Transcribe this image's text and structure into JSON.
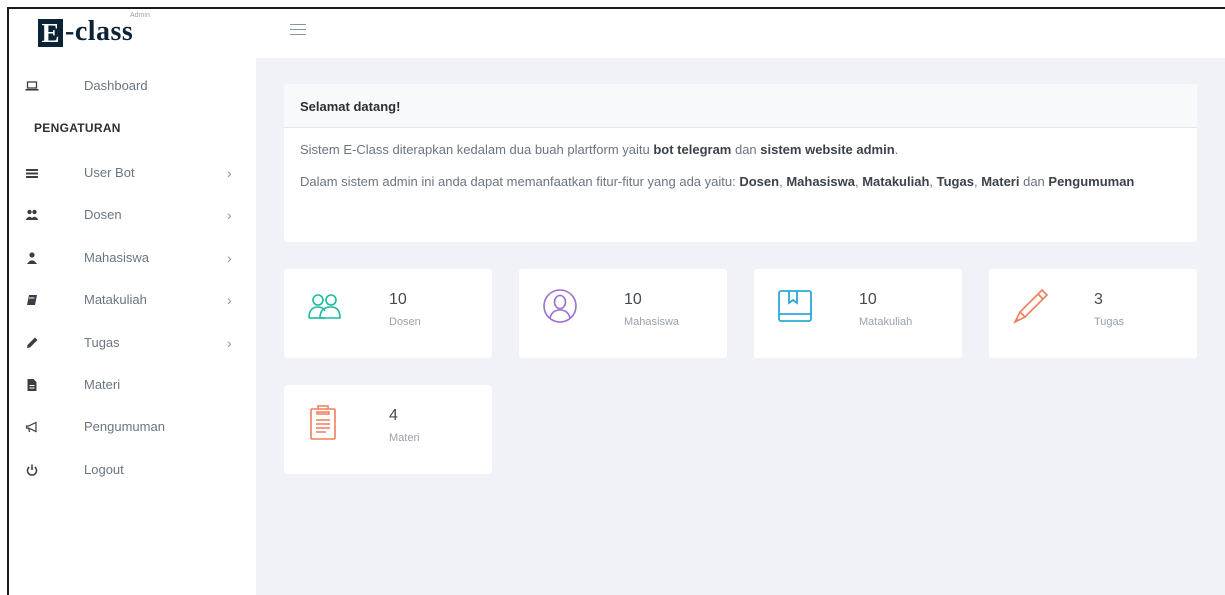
{
  "brand": {
    "letter": "E",
    "rest": "-class",
    "badge": "Admin"
  },
  "sidebar": {
    "section_title": "PENGATURAN",
    "dashboard": {
      "label": "Dashboard",
      "icon": "laptop-icon"
    },
    "items": [
      {
        "label": "User Bot",
        "icon": "list-icon",
        "has_submenu": true
      },
      {
        "label": "Dosen",
        "icon": "users-icon",
        "has_submenu": true
      },
      {
        "label": "Mahasiswa",
        "icon": "user-icon",
        "has_submenu": true
      },
      {
        "label": "Matakuliah",
        "icon": "book-icon",
        "has_submenu": true
      },
      {
        "label": "Tugas",
        "icon": "pencil-icon",
        "has_submenu": true
      },
      {
        "label": "Materi",
        "icon": "file-icon",
        "has_submenu": false
      },
      {
        "label": "Pengumuman",
        "icon": "bullhorn-icon",
        "has_submenu": false
      },
      {
        "label": "Logout",
        "icon": "power-icon",
        "has_submenu": false
      }
    ],
    "chevron": "›"
  },
  "welcome": {
    "title": "Selamat datang!",
    "p1_a": "Sistem E-Class diterapkan kedalam dua buah plartform yaitu ",
    "p1_b": "bot telegram",
    "p1_c": " dan ",
    "p1_d": "sistem website admin",
    "p1_e": ".",
    "p2_a": "Dalam sistem admin ini anda dapat memanfaatkan fitur-fitur yang ada yaitu: ",
    "p2_dosen": "Dosen",
    "p2_sep1": ", ",
    "p2_mahasiswa": "Mahasiswa",
    "p2_sep2": ", ",
    "p2_matakuliah": "Matakuliah",
    "p2_sep3": ", ",
    "p2_tugas": "Tugas",
    "p2_sep4": ", ",
    "p2_materi": "Materi",
    "p2_dan": " dan ",
    "p2_pengumuman": "Pengumuman"
  },
  "stats": [
    {
      "value": "10",
      "label": "Dosen",
      "icon": "users-outline-icon",
      "color": "#1abc9c"
    },
    {
      "value": "10",
      "label": "Mahasiswa",
      "icon": "user-circle-icon",
      "color": "#9b6fd0"
    },
    {
      "value": "10",
      "label": "Matakuliah",
      "icon": "book-outline-icon",
      "color": "#2aa9d6"
    },
    {
      "value": "3",
      "label": "Tugas",
      "icon": "pen-icon",
      "color": "#ef7f5a"
    },
    {
      "value": "4",
      "label": "Materi",
      "icon": "clipboard-icon",
      "color": "#ef7f5a"
    }
  ],
  "colors": {
    "main_bg": "#f1f2f7",
    "brand_dark": "#0c2336"
  }
}
